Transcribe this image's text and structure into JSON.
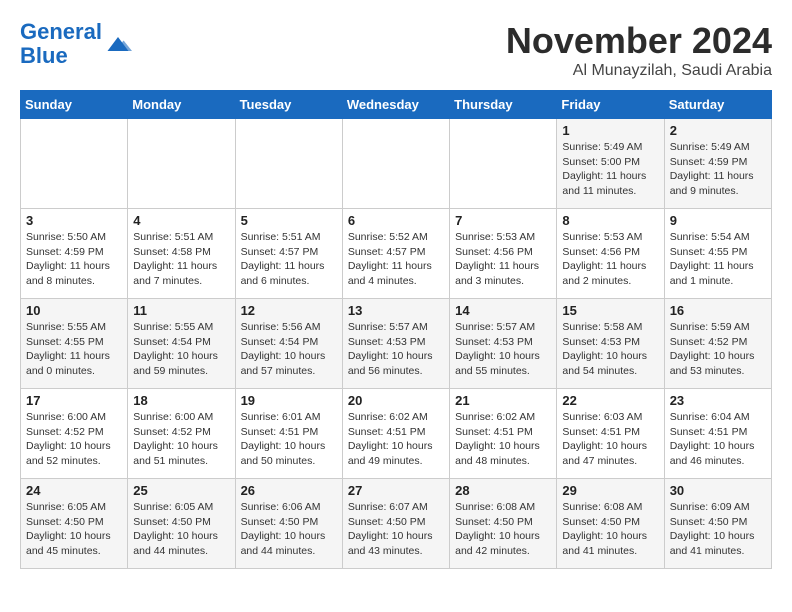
{
  "header": {
    "logo_line1": "General",
    "logo_line2": "Blue",
    "month": "November 2024",
    "location": "Al Munayzilah, Saudi Arabia"
  },
  "days_of_week": [
    "Sunday",
    "Monday",
    "Tuesday",
    "Wednesday",
    "Thursday",
    "Friday",
    "Saturday"
  ],
  "weeks": [
    [
      {
        "day": "",
        "info": ""
      },
      {
        "day": "",
        "info": ""
      },
      {
        "day": "",
        "info": ""
      },
      {
        "day": "",
        "info": ""
      },
      {
        "day": "",
        "info": ""
      },
      {
        "day": "1",
        "info": "Sunrise: 5:49 AM\nSunset: 5:00 PM\nDaylight: 11 hours and 11 minutes."
      },
      {
        "day": "2",
        "info": "Sunrise: 5:49 AM\nSunset: 4:59 PM\nDaylight: 11 hours and 9 minutes."
      }
    ],
    [
      {
        "day": "3",
        "info": "Sunrise: 5:50 AM\nSunset: 4:59 PM\nDaylight: 11 hours and 8 minutes."
      },
      {
        "day": "4",
        "info": "Sunrise: 5:51 AM\nSunset: 4:58 PM\nDaylight: 11 hours and 7 minutes."
      },
      {
        "day": "5",
        "info": "Sunrise: 5:51 AM\nSunset: 4:57 PM\nDaylight: 11 hours and 6 minutes."
      },
      {
        "day": "6",
        "info": "Sunrise: 5:52 AM\nSunset: 4:57 PM\nDaylight: 11 hours and 4 minutes."
      },
      {
        "day": "7",
        "info": "Sunrise: 5:53 AM\nSunset: 4:56 PM\nDaylight: 11 hours and 3 minutes."
      },
      {
        "day": "8",
        "info": "Sunrise: 5:53 AM\nSunset: 4:56 PM\nDaylight: 11 hours and 2 minutes."
      },
      {
        "day": "9",
        "info": "Sunrise: 5:54 AM\nSunset: 4:55 PM\nDaylight: 11 hours and 1 minute."
      }
    ],
    [
      {
        "day": "10",
        "info": "Sunrise: 5:55 AM\nSunset: 4:55 PM\nDaylight: 11 hours and 0 minutes."
      },
      {
        "day": "11",
        "info": "Sunrise: 5:55 AM\nSunset: 4:54 PM\nDaylight: 10 hours and 59 minutes."
      },
      {
        "day": "12",
        "info": "Sunrise: 5:56 AM\nSunset: 4:54 PM\nDaylight: 10 hours and 57 minutes."
      },
      {
        "day": "13",
        "info": "Sunrise: 5:57 AM\nSunset: 4:53 PM\nDaylight: 10 hours and 56 minutes."
      },
      {
        "day": "14",
        "info": "Sunrise: 5:57 AM\nSunset: 4:53 PM\nDaylight: 10 hours and 55 minutes."
      },
      {
        "day": "15",
        "info": "Sunrise: 5:58 AM\nSunset: 4:53 PM\nDaylight: 10 hours and 54 minutes."
      },
      {
        "day": "16",
        "info": "Sunrise: 5:59 AM\nSunset: 4:52 PM\nDaylight: 10 hours and 53 minutes."
      }
    ],
    [
      {
        "day": "17",
        "info": "Sunrise: 6:00 AM\nSunset: 4:52 PM\nDaylight: 10 hours and 52 minutes."
      },
      {
        "day": "18",
        "info": "Sunrise: 6:00 AM\nSunset: 4:52 PM\nDaylight: 10 hours and 51 minutes."
      },
      {
        "day": "19",
        "info": "Sunrise: 6:01 AM\nSunset: 4:51 PM\nDaylight: 10 hours and 50 minutes."
      },
      {
        "day": "20",
        "info": "Sunrise: 6:02 AM\nSunset: 4:51 PM\nDaylight: 10 hours and 49 minutes."
      },
      {
        "day": "21",
        "info": "Sunrise: 6:02 AM\nSunset: 4:51 PM\nDaylight: 10 hours and 48 minutes."
      },
      {
        "day": "22",
        "info": "Sunrise: 6:03 AM\nSunset: 4:51 PM\nDaylight: 10 hours and 47 minutes."
      },
      {
        "day": "23",
        "info": "Sunrise: 6:04 AM\nSunset: 4:51 PM\nDaylight: 10 hours and 46 minutes."
      }
    ],
    [
      {
        "day": "24",
        "info": "Sunrise: 6:05 AM\nSunset: 4:50 PM\nDaylight: 10 hours and 45 minutes."
      },
      {
        "day": "25",
        "info": "Sunrise: 6:05 AM\nSunset: 4:50 PM\nDaylight: 10 hours and 44 minutes."
      },
      {
        "day": "26",
        "info": "Sunrise: 6:06 AM\nSunset: 4:50 PM\nDaylight: 10 hours and 44 minutes."
      },
      {
        "day": "27",
        "info": "Sunrise: 6:07 AM\nSunset: 4:50 PM\nDaylight: 10 hours and 43 minutes."
      },
      {
        "day": "28",
        "info": "Sunrise: 6:08 AM\nSunset: 4:50 PM\nDaylight: 10 hours and 42 minutes."
      },
      {
        "day": "29",
        "info": "Sunrise: 6:08 AM\nSunset: 4:50 PM\nDaylight: 10 hours and 41 minutes."
      },
      {
        "day": "30",
        "info": "Sunrise: 6:09 AM\nSunset: 4:50 PM\nDaylight: 10 hours and 41 minutes."
      }
    ]
  ]
}
